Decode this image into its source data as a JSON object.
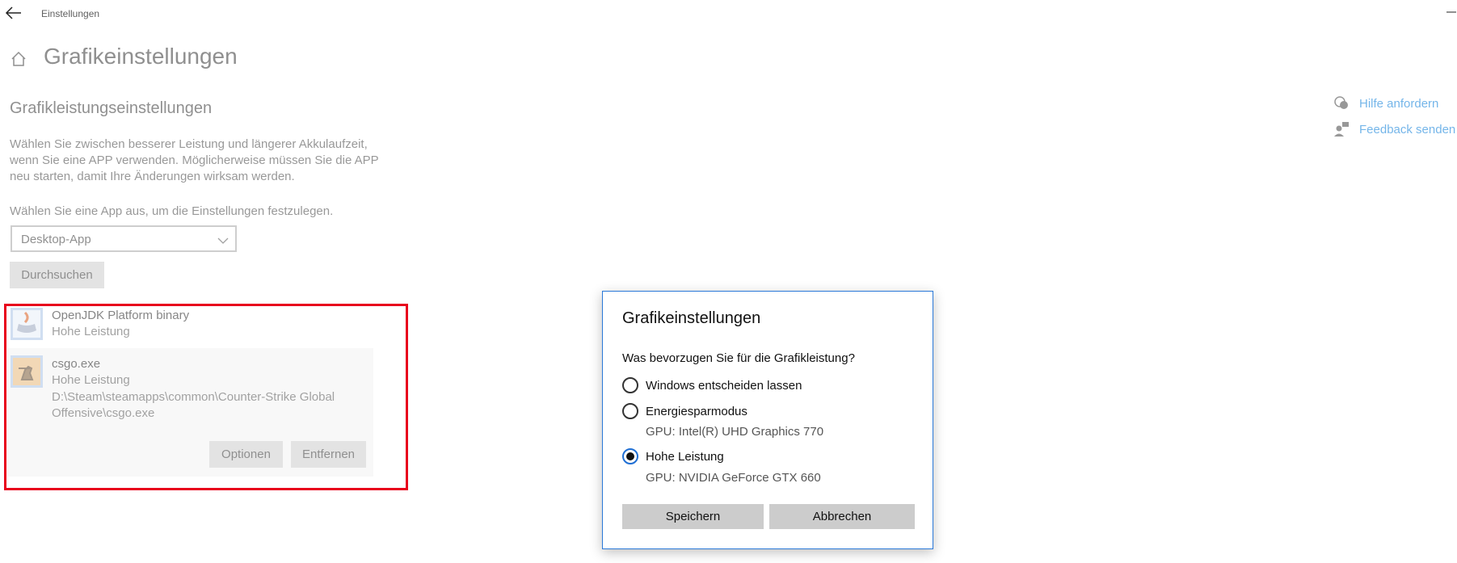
{
  "window": {
    "title": "Einstellungen"
  },
  "page": {
    "title": "Grafikeinstellungen",
    "section_title": "Grafikleistungseinstellungen",
    "description": "Wählen Sie zwischen besserer Leistung und längerer Akkulaufzeit, wenn Sie eine APP verwenden. Möglicherweise müssen Sie die APP neu starten, damit Ihre Änderungen wirksam werden.",
    "choose_label": "Wählen Sie eine App aus, um die Einstellungen festzulegen.",
    "app_type_select": {
      "value": "Desktop-App"
    },
    "browse_label": "Durchsuchen"
  },
  "apps": [
    {
      "name": "OpenJDK Platform binary",
      "preference": "Hohe Leistung"
    },
    {
      "name": "csgo.exe",
      "preference": "Hohe Leistung",
      "path": "D:\\Steam\\steamapps\\common\\Counter-Strike Global Offensive\\csgo.exe",
      "options_label": "Optionen",
      "remove_label": "Entfernen"
    }
  ],
  "side_links": {
    "help": "Hilfe anfordern",
    "feedback": "Feedback senden"
  },
  "dialog": {
    "title": "Grafikeinstellungen",
    "question": "Was bevorzugen Sie für die Grafikleistung?",
    "options": [
      {
        "label": "Windows entscheiden lassen",
        "checked": false
      },
      {
        "label": "Energiesparmodus",
        "gpu": "GPU: Intel(R) UHD Graphics 770",
        "checked": false
      },
      {
        "label": "Hohe Leistung",
        "gpu": "GPU: NVIDIA GeForce GTX 660",
        "checked": true
      }
    ],
    "save_label": "Speichern",
    "cancel_label": "Abbrechen"
  },
  "colors": {
    "accent": "#0078d7",
    "highlight_border": "#e8001c",
    "dialog_border": "#2b79d8"
  }
}
